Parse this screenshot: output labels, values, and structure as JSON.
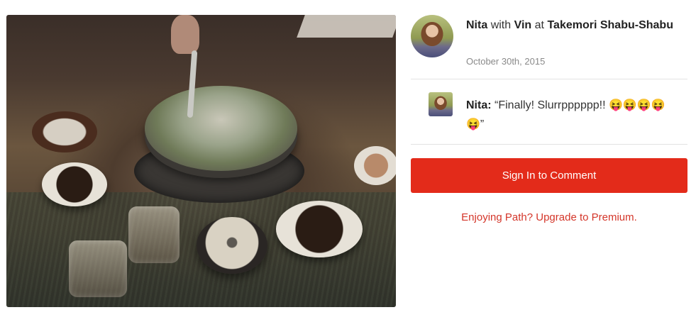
{
  "moment": {
    "author": "Nita",
    "with_word": "with",
    "companion": "Vin",
    "at_word": "at",
    "place": "Takemori Shabu-Shabu",
    "date": "October 30th, 2015"
  },
  "comment": {
    "author": "Nita:",
    "text": "“Finally! Slurrpppppp!! 😝😝😝😝😝”"
  },
  "actions": {
    "signin_label": "Sign In to Comment",
    "upgrade_label": "Enjoying Path? Upgrade to Premium."
  },
  "colors": {
    "accent": "#e32b1a",
    "link": "#d4362a"
  },
  "photo": {
    "description_icon": "food-photo"
  }
}
